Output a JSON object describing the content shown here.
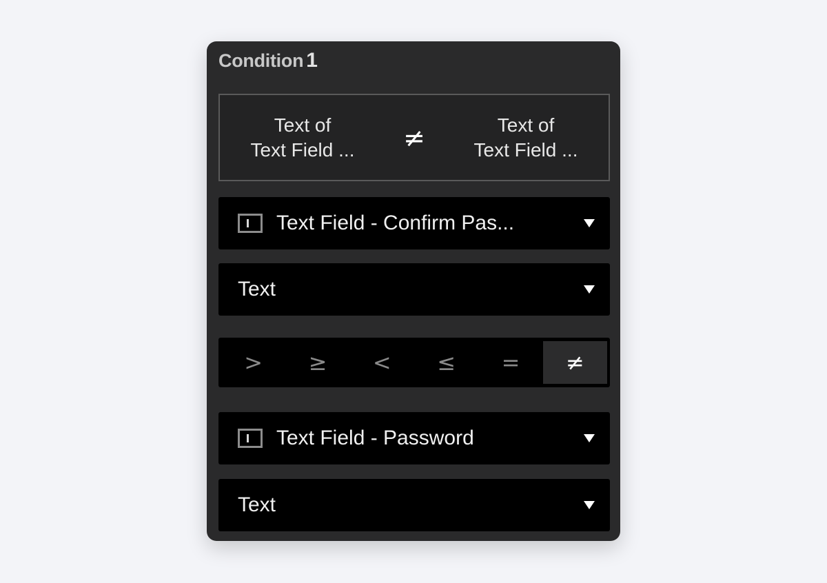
{
  "panel": {
    "title": "Condition",
    "number": "1"
  },
  "summary": {
    "left_line1": "Text of",
    "left_line2": "Text Field ...",
    "operator": "≠",
    "right_line1": "Text of",
    "right_line2": "Text Field ..."
  },
  "left_operand": {
    "element_icon": "text-field-icon",
    "element_label": "Text Field - Confirm Pas...",
    "property_label": "Text"
  },
  "operators": {
    "items": [
      ">",
      "≥",
      "<",
      "≤",
      "=",
      "≠"
    ],
    "selected": "≠"
  },
  "right_operand": {
    "element_icon": "text-field-icon",
    "element_label": "Text Field - Password",
    "property_label": "Text"
  },
  "colors": {
    "page_background": "#f3f4f8",
    "panel_background": "#2a2a2b",
    "control_background": "#000000",
    "active_operator_background": "#2c2c2d"
  }
}
